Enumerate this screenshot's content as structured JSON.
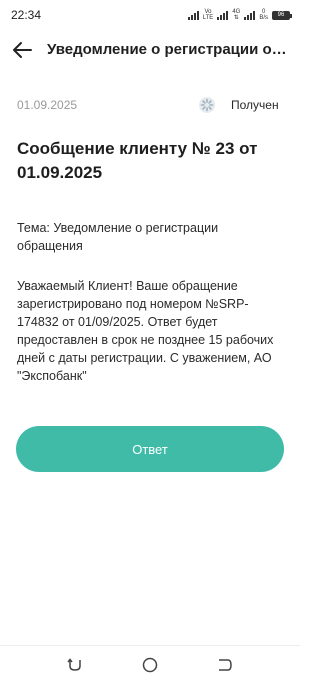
{
  "status_bar": {
    "time": "22:34",
    "net_volte": "Vo",
    "net_lte": "LTE",
    "net_4g": "4G",
    "speed_value": "0",
    "speed_unit": "B/s",
    "battery": "96"
  },
  "header": {
    "back_icon": "arrow-left-icon",
    "title": "Уведомление о регистрации обращения"
  },
  "meta": {
    "date": "01.09.2025",
    "status_icon": "status-spinner-icon",
    "status": "Получен"
  },
  "message": {
    "title": "Сообщение клиенту № 23 от 01.09.2025",
    "subject": "Тема: Уведомление о регистрации обращения",
    "body": "Уважаемый Клиент! Ваше обращение зарегистрировано под номером №SRP-174832 от 01/09/2025. Ответ будет предоставлен в срок не позднее 15 рабочих дней с даты регистрации. С уважением, АО \"Экспобанк\""
  },
  "actions": {
    "answer_label": "Ответ",
    "accent_color": "#3fbba8"
  },
  "nav": {
    "back_icon": "nav-back-icon",
    "home_icon": "nav-home-icon",
    "recents_icon": "nav-recents-icon"
  }
}
